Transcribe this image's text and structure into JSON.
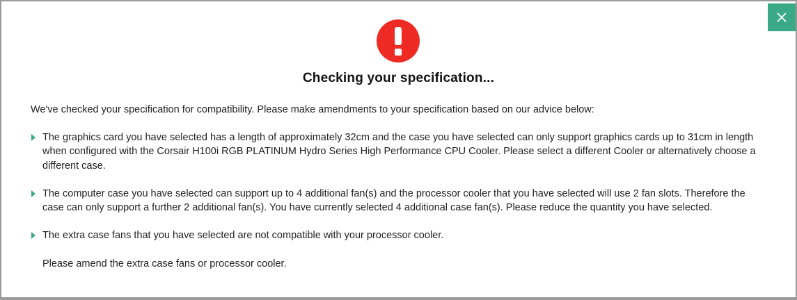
{
  "modal": {
    "close_icon": "close-icon",
    "alert_icon": "exclamation-circle-icon",
    "title": "Checking your specification...",
    "intro": "We've checked your specification for compatibility. Please make amendments to your specification based on our advice below:",
    "advice": [
      {
        "lines": [
          "The graphics card you have selected has a length of approximately 32cm and the case you have selected can only support graphics cards up to 31cm in length when configured with the Corsair H100i RGB PLATINUM Hydro Series High Performance CPU Cooler. Please select a different Cooler or alternatively choose a different case."
        ]
      },
      {
        "lines": [
          "The computer case you have selected can support up to 4 additional fan(s) and the processor cooler that you have selected will use 2 fan slots. Therefore the case can only support a further 2 additional fan(s). You have currently selected 4 additional case fan(s). Please reduce the quantity you have selected."
        ]
      },
      {
        "lines": [
          "The extra case fans that you have selected are not compatible with your processor cooler.",
          "Please amend the extra case fans or processor cooler."
        ]
      }
    ]
  },
  "colors": {
    "accent": "#3aaa86",
    "alert": "#ee2a24"
  }
}
